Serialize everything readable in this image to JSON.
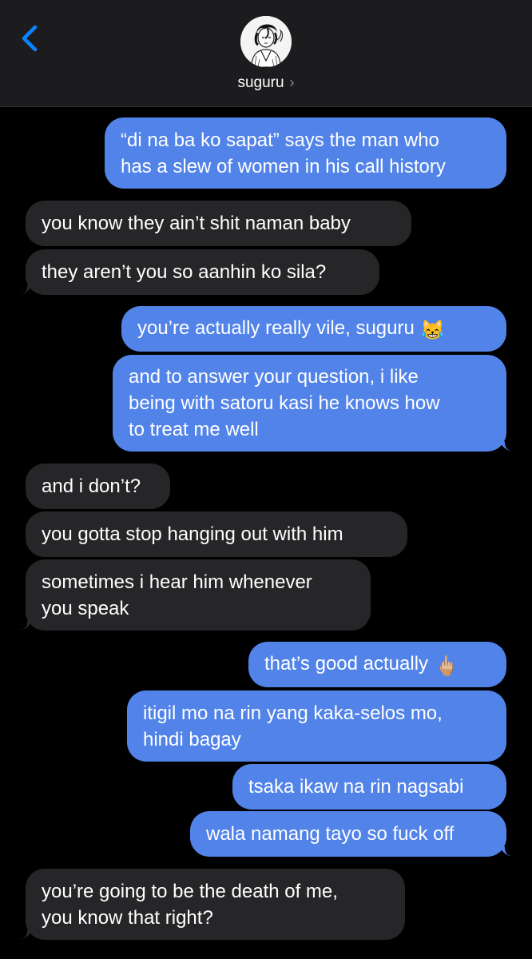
{
  "header": {
    "contact_name": "suguru",
    "back_icon": "chevron-left-icon",
    "detail_icon": "chevron-right-icon",
    "avatar_icon": "avatar-manga-portrait"
  },
  "colors": {
    "sent_bubble": "#5283e8",
    "received_bubble": "#262629",
    "background": "#000000",
    "header_bg": "#1c1c1e",
    "accent": "#0a84ff"
  },
  "messages": [
    {
      "direction": "sent",
      "lines": [
        "“di na ba ko sapat” says the man who",
        "has a slew of women in his call history"
      ]
    },
    {
      "direction": "received",
      "lines": [
        "you know they ain’t shit naman baby"
      ]
    },
    {
      "direction": "received",
      "lines": [
        "they aren’t you so aanhin ko sila?"
      ]
    },
    {
      "direction": "sent",
      "lines": [
        "you’re actually really vile, suguru"
      ],
      "emoji": "😹"
    },
    {
      "direction": "sent",
      "lines": [
        "and to answer your question, i like",
        "being with satoru kasi he knows how",
        "to treat me well"
      ]
    },
    {
      "direction": "received",
      "lines": [
        "and i don’t?"
      ]
    },
    {
      "direction": "received",
      "lines": [
        "you gotta stop hanging out with him"
      ]
    },
    {
      "direction": "received",
      "lines": [
        "sometimes i hear him whenever",
        "you speak"
      ]
    },
    {
      "direction": "sent",
      "lines": [
        "that’s good actually"
      ],
      "emoji": "🖕🏼"
    },
    {
      "direction": "sent",
      "lines": [
        "itigil mo na rin yang kaka-selos mo,",
        "hindi bagay"
      ]
    },
    {
      "direction": "sent",
      "lines": [
        "tsaka ikaw na rin nagsabi"
      ]
    },
    {
      "direction": "sent",
      "lines": [
        "wala namang tayo so fuck off"
      ]
    },
    {
      "direction": "received",
      "lines": [
        "you’re going to be the death of me,",
        "you know that right?"
      ]
    }
  ]
}
